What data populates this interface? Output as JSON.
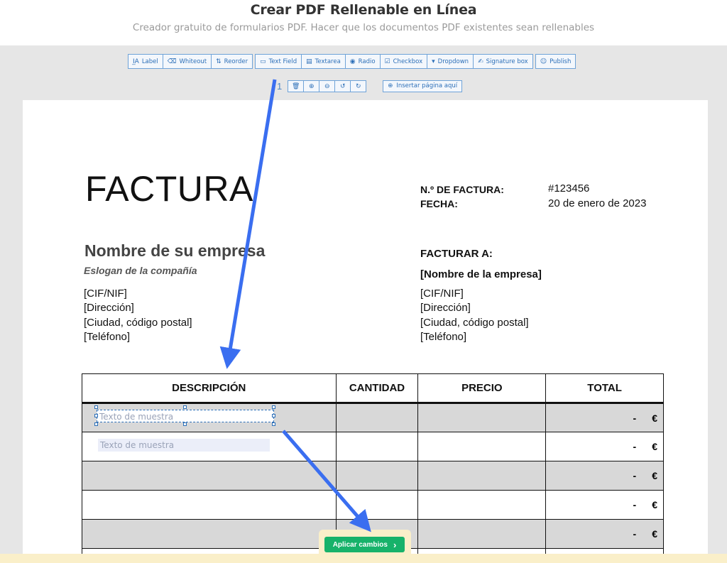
{
  "header": {
    "title": "Crear PDF Rellenable en Línea",
    "subtitle": "Creador gratuito de formularios PDF. Hacer que los documentos PDF existentes sean rellenables"
  },
  "toolbar": [
    {
      "label": "Label",
      "icon": "label-icon"
    },
    {
      "label": "Whiteout",
      "icon": "eraser-icon"
    },
    {
      "label": "Reorder",
      "icon": "reorder-icon"
    },
    {
      "label": "Text Field",
      "icon": "text-field-icon"
    },
    {
      "label": "Textarea",
      "icon": "textarea-icon"
    },
    {
      "label": "Radio",
      "icon": "radio-icon"
    },
    {
      "label": "Checkbox",
      "icon": "checkbox-icon"
    },
    {
      "label": "Dropdown",
      "icon": "dropdown-icon"
    },
    {
      "label": "Signature box",
      "icon": "signature-icon"
    },
    {
      "label": "Publish",
      "icon": "users-icon"
    }
  ],
  "page_controls": {
    "page_number": "1",
    "insert_page_label": "Insertar página aquí"
  },
  "invoice": {
    "title": "FACTURA",
    "number_label": "N.º DE FACTURA:",
    "number_value": "#123456",
    "date_label": "FECHA:",
    "date_value": "20 de enero de 2023",
    "company_name": "Nombre de su empresa",
    "slogan": "Eslogan de la compañía",
    "sender": [
      "[CIF/NIF]",
      "[Dirección]",
      "[Ciudad, código postal]",
      "[Teléfono]"
    ],
    "bill_to_label": "FACTURAR A:",
    "bill_to_company": "[Nombre de la empresa]",
    "recipient": [
      "[CIF/NIF]",
      "[Dirección]",
      "[Ciudad, código postal]",
      "[Teléfono]"
    ],
    "columns": [
      "DESCRIPCIÓN",
      "CANTIDAD",
      "PRECIO",
      "TOTAL"
    ],
    "row_total_dash": "-",
    "currency": "€"
  },
  "fields": {
    "placeholder_1": "Texto de muestra",
    "placeholder_2": "Texto de muestra"
  },
  "apply_button": {
    "label": "Aplicar cambios",
    "arrow": "›"
  },
  "colors": {
    "accent": "#2c6fb8",
    "arrow": "#3a6ef0",
    "apply": "#17b26a"
  }
}
